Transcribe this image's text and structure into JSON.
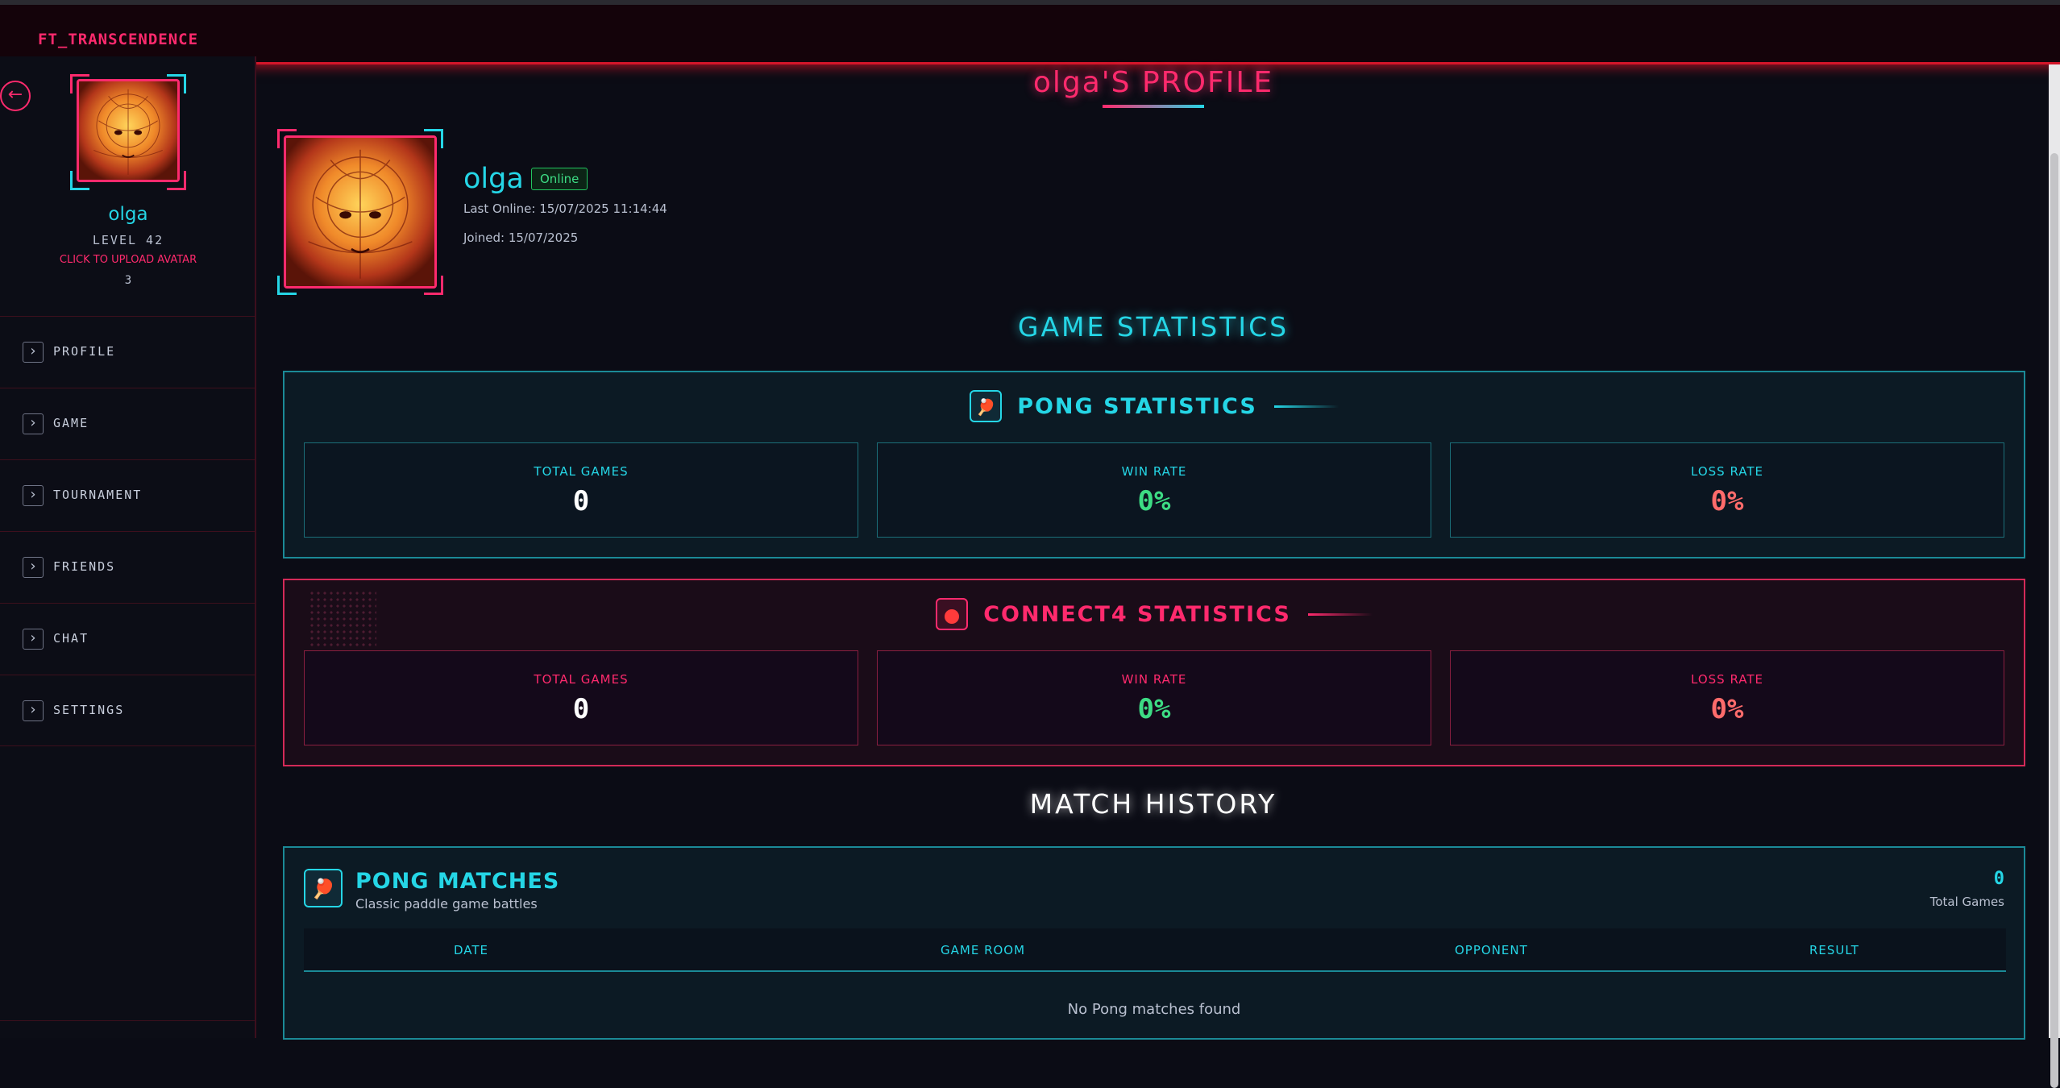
{
  "app": {
    "brand": "FT_TRANSCENDENCE"
  },
  "sidebar": {
    "username": "olga",
    "level": "LEVEL 42",
    "upload_label": "CLICK TO UPLOAD AVATAR",
    "count": "3",
    "items": [
      {
        "label": "PROFILE"
      },
      {
        "label": "GAME"
      },
      {
        "label": "TOURNAMENT"
      },
      {
        "label": "FRIENDS"
      },
      {
        "label": "CHAT"
      },
      {
        "label": "SETTINGS"
      }
    ]
  },
  "profile": {
    "page_title": "olga'S PROFILE",
    "name": "olga",
    "status": "Online",
    "last_online": "Last Online: 15/07/2025 11:14:44",
    "joined": "Joined: 15/07/2025"
  },
  "stats": {
    "section_title": "GAME STATISTICS",
    "pong": {
      "title": "PONG STATISTICS",
      "total_games_label": "TOTAL GAMES",
      "total_games": "0",
      "win_rate_label": "WIN RATE",
      "win_rate": "0%",
      "loss_rate_label": "LOSS RATE",
      "loss_rate": "0%"
    },
    "connect4": {
      "title": "CONNECT4 STATISTICS",
      "total_games_label": "TOTAL GAMES",
      "total_games": "0",
      "win_rate_label": "WIN RATE",
      "win_rate": "0%",
      "loss_rate_label": "LOSS RATE",
      "loss_rate": "0%"
    }
  },
  "history": {
    "section_title": "MATCH HISTORY",
    "pong": {
      "title": "PONG MATCHES",
      "subtitle": "Classic paddle game battles",
      "count": "0",
      "count_label": "Total Games",
      "columns": [
        "DATE",
        "GAME ROOM",
        "OPPONENT",
        "RESULT"
      ],
      "empty": "No Pong matches found"
    }
  },
  "colors": {
    "accent_pink": "#ff2a6d",
    "accent_cyan": "#25d6e6",
    "win_green": "#3ddc84",
    "loss_red": "#ff6b6b"
  },
  "icons": {
    "back": "arrow-left-icon",
    "nav": "chevron-right-icon",
    "pong": "ping-pong-paddle-icon",
    "connect4": "red-disc-icon"
  }
}
